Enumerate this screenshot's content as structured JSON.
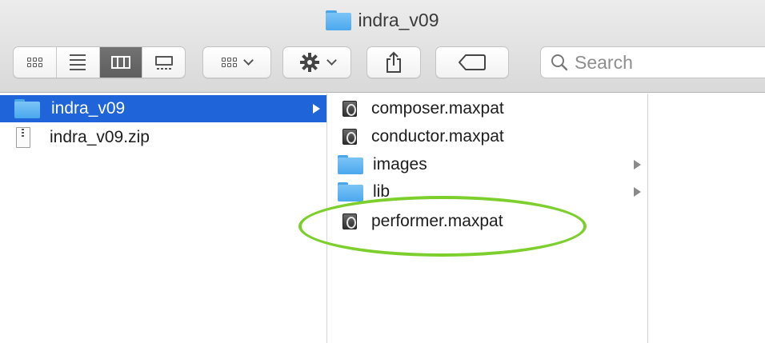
{
  "window": {
    "title": "indra_v09"
  },
  "toolbar": {
    "views": [
      "icon-view",
      "list-view",
      "column-view",
      "gallery-view"
    ],
    "active_view": "column-view",
    "search_placeholder": "Search"
  },
  "columns": {
    "col1": {
      "items": [
        {
          "label": "indra_v09",
          "type": "folder",
          "selected": true,
          "has_children": true
        },
        {
          "label": "indra_v09.zip",
          "type": "zip"
        }
      ]
    },
    "col2": {
      "items": [
        {
          "label": "composer.maxpat",
          "type": "maxpat"
        },
        {
          "label": "conductor.maxpat",
          "type": "maxpat"
        },
        {
          "label": "images",
          "type": "folder",
          "has_children": true
        },
        {
          "label": "lib",
          "type": "folder",
          "has_children": true
        },
        {
          "label": "performer.maxpat",
          "type": "maxpat",
          "highlighted": true
        }
      ]
    }
  },
  "colors": {
    "selection": "#1f64d8",
    "folder": "#5cb3f2",
    "annotation": "#7ccf2c"
  }
}
